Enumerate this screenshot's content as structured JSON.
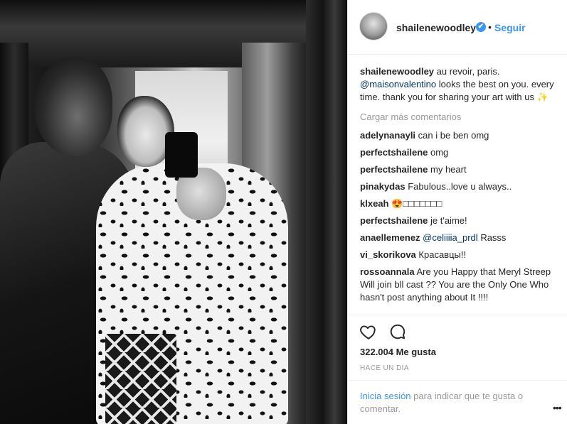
{
  "post": {
    "username": "shailenewoodley",
    "verified_symbol": "✔",
    "separator": "•",
    "follow_label": "Seguir"
  },
  "caption": {
    "username": "shailenewoodley",
    "text_before": " au revoir, paris. ",
    "mention": "@maisonvalentino",
    "text_after": " looks the best on you. every time. thank you for sharing your art with us ✨"
  },
  "load_more_label": "Cargar más comentarios",
  "comments": [
    {
      "user": "adelynanayli",
      "text": "can i be ben omg"
    },
    {
      "user": "perfectshailene",
      "text": "omg"
    },
    {
      "user": "perfectshailene",
      "text": "my heart"
    },
    {
      "user": "pinakydas",
      "text": "Fabulous..love u always.."
    },
    {
      "user": "klxeah",
      "text": "😍□□□□□□□"
    },
    {
      "user": "perfectshailene",
      "text": "je t'aime!"
    },
    {
      "user": "anaellemenez",
      "mention": "@celiiiia_prdl",
      "text": "Rasss"
    },
    {
      "user": "vi_skorikova",
      "text": "Красавцы!!"
    },
    {
      "user": "rossoannala",
      "text": "Are you Happy that Meryl Streep Will join bll cast ?? You are the Only One Who hasn't post anything about It !!!!"
    }
  ],
  "icons": {
    "like": "heart-icon",
    "comment": "comment-icon",
    "more": "more-options-icon",
    "avatar": "profile-avatar"
  },
  "likes_label": "322.004 Me gusta",
  "time_label": "HACE UN DÍA",
  "login_prompt": {
    "link": "Inicia sesión",
    "text": " para indicar que te gusta o comentar."
  },
  "more_label": "•••",
  "colors": {
    "accent": "#3897f0",
    "text": "#262626",
    "muted": "#999999",
    "mention": "#003569"
  }
}
